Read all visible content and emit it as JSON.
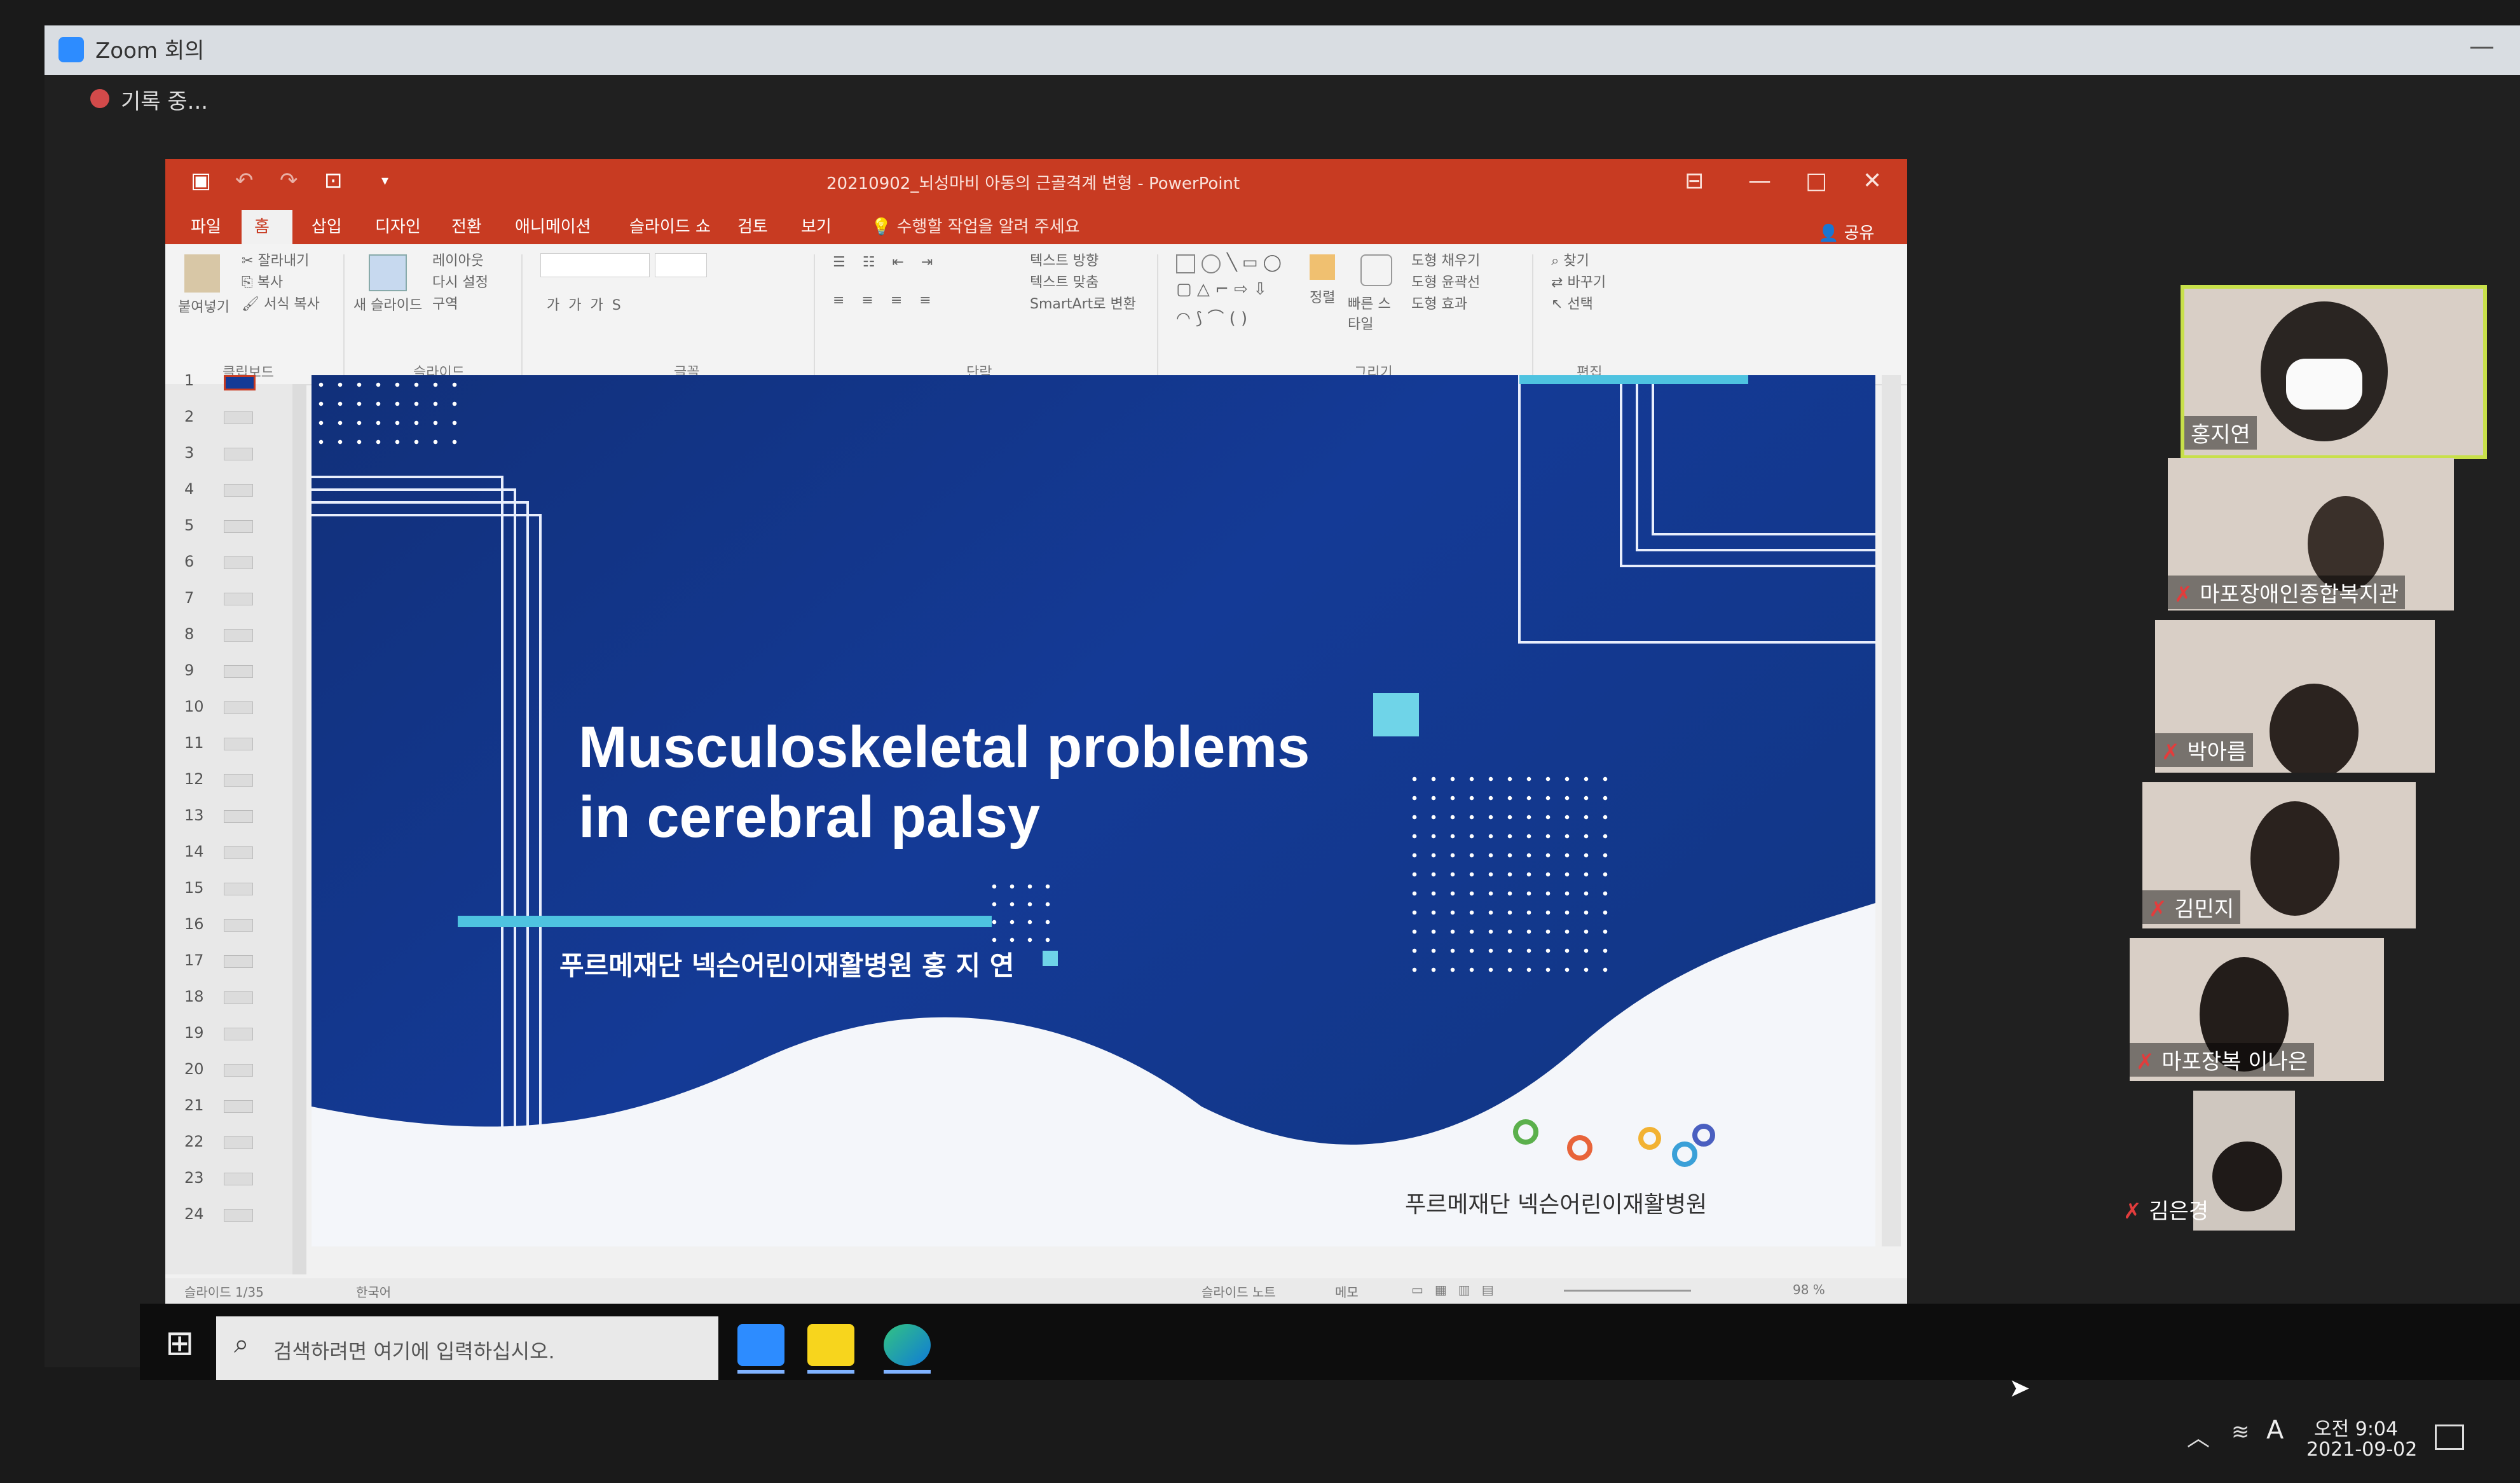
{
  "zoom": {
    "title": "Zoom 회의",
    "recording": "기록 중..."
  },
  "powerpoint": {
    "title": "20210902_뇌성마비 아동의 근골격계 변형 - PowerPoint",
    "tabs": [
      "파일",
      "홈",
      "삽입",
      "디자인",
      "전환",
      "애니메이션",
      "슬라이드 쇼",
      "검토",
      "보기"
    ],
    "tell_me": "수행할 작업을 알려 주세요",
    "share": "공유",
    "ribbon": {
      "clipboard": {
        "paste": "붙여넣기",
        "cut": "잘라내기",
        "copy": "복사",
        "format_painter": "서식 복사",
        "label": "클립보드"
      },
      "slides": {
        "new_slide": "새 슬라이드",
        "layout": "레이아웃",
        "reset": "다시 설정",
        "section": "구역",
        "label": "슬라이드"
      },
      "font": {
        "label": "글꼴"
      },
      "paragraph": {
        "text_direction": "텍스트 방향",
        "align_text": "텍스트 맞춤",
        "smartart": "SmartArt로 변환",
        "label": "단락"
      },
      "drawing": {
        "arrange": "정렬",
        "quick_styles": "빠른 스타일",
        "shape_fill": "도형 채우기",
        "shape_outline": "도형 윤곽선",
        "shape_effects": "도형 효과",
        "label": "그리기"
      },
      "editing": {
        "find": "찾기",
        "replace": "바꾸기",
        "select": "선택",
        "label": "편집"
      }
    },
    "thumbnails": [
      "1",
      "2",
      "3",
      "4",
      "5",
      "6",
      "7",
      "8",
      "9",
      "10",
      "11",
      "12",
      "13",
      "14",
      "15",
      "16",
      "17",
      "18",
      "19",
      "20",
      "21",
      "22",
      "23",
      "24"
    ],
    "slide": {
      "title_line1": "Musculoskeletal problems",
      "title_line2": "in cerebral palsy",
      "subtitle": "푸르메재단 넥슨어린이재활병원 홍 지 연",
      "footer_org": "푸르메재단 넥슨어린이재활병원"
    },
    "status": {
      "slide_count": "슬라이드 1/35",
      "language": "한국어",
      "notes": "슬라이드 노트",
      "comments": "메모",
      "zoom_pct": "98 %"
    }
  },
  "participants": [
    {
      "name": "홍지연",
      "muted": false,
      "active": true
    },
    {
      "name": "마포장애인종합복지관",
      "muted": true,
      "active": false
    },
    {
      "name": "박아름",
      "muted": true,
      "active": false
    },
    {
      "name": "김민지",
      "muted": true,
      "active": false
    },
    {
      "name": "마포장복 이나은",
      "muted": true,
      "active": false
    },
    {
      "name": "김은경",
      "muted": true,
      "active": false
    }
  ],
  "taskbar": {
    "search_placeholder": "검색하려면 여기에 입력하십시오.",
    "time": "오전 9:04",
    "date": "2021-09-02",
    "ime": "A",
    "apps": [
      "zoom-app",
      "kakaotalk-app",
      "edge-app"
    ]
  },
  "colors": {
    "ppt_accent": "#c83b22",
    "slide_blue": "#143a96",
    "cyan": "#4ec3e0",
    "active_speaker": "#c8e04a"
  }
}
